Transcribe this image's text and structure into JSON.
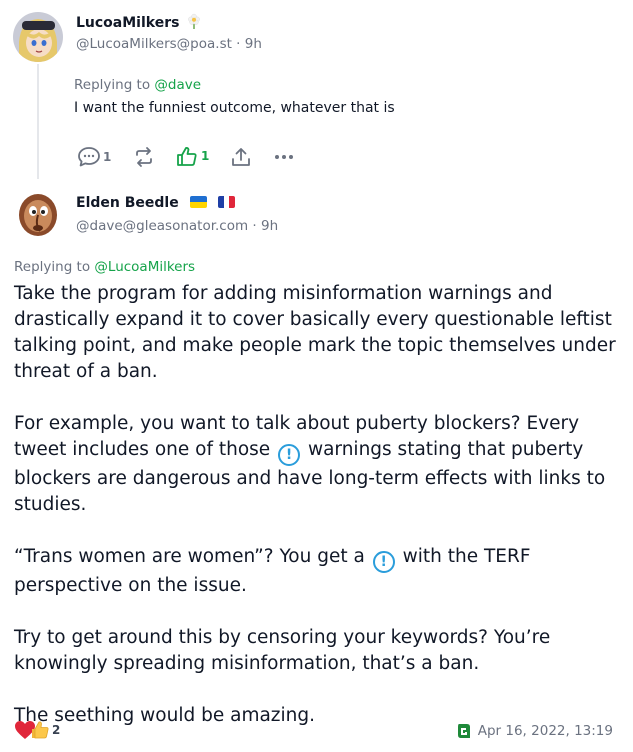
{
  "post1": {
    "name": "LucoaMilkers",
    "handle": "@LucoaMilkers@poa.st · 9h",
    "replying_prefix": "Replying to ",
    "replying_to": "@dave",
    "text": "I want the funniest outcome, whatever that is",
    "actions": {
      "replies": "1",
      "likes": "1"
    }
  },
  "post2": {
    "name": "Elden Beedle",
    "handle": "@dave@gleasonator.com · 9h",
    "replying_prefix": "Replying to ",
    "replying_to": "@LucoaMilkers",
    "para1": "Take the program for adding misinformation warnings and drastically expand it to cover basically every questionable leftist talking point, and make people mark the topic themselves under threat of a ban.",
    "para2_a": "For example, you want to talk about puberty blockers? Every tweet includes one of those",
    "para2_b": "warnings stating that puberty blockers are dangerous and have long-term effects with links to studies.",
    "para3_a": "“Trans women are women”? You get a",
    "para3_b": "with the TERF perspective on the issue.",
    "para4": "Try to get around this by censoring your keywords? You’re knowingly spreading misinformation, that’s a ban.",
    "para5": "The seething would be amazing.",
    "warning_glyph": "!",
    "reactions_count": "2",
    "date": "Apr 16, 2022, 13:19"
  },
  "colors": {
    "accent_green": "#16a34a",
    "warning_blue": "#2a9ddb",
    "muted": "#6b7280"
  }
}
